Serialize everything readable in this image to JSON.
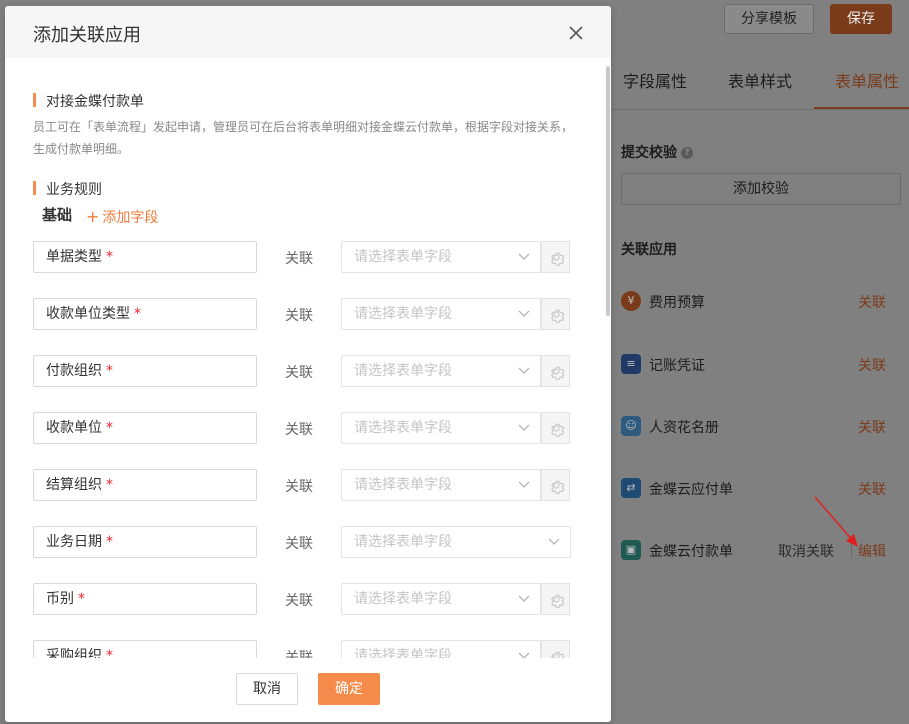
{
  "background": {
    "toolbar": {
      "share_label": "分享模板",
      "save_label": "保存"
    },
    "tabs": [
      {
        "label": "字段属性"
      },
      {
        "label": "表单样式"
      },
      {
        "label": "表单属性"
      }
    ],
    "submit_check": {
      "title": "提交校验",
      "add_button": "添加校验"
    },
    "related_apps": {
      "title": "关联应用",
      "items": [
        {
          "name": "费用预算",
          "icon": "yen-icon",
          "icon_color": "#7a3b1b",
          "action": "关联"
        },
        {
          "name": "记账凭证",
          "icon": "ledger-icon",
          "icon_color": "#1f3a66",
          "action": "关联"
        },
        {
          "name": "人资花名册",
          "icon": "person-icon",
          "icon_color": "#2d5b80",
          "action": "关联"
        },
        {
          "name": "金蝶云应付单",
          "icon": "exchange-icon",
          "icon_color": "#1f4a73",
          "action": "关联"
        },
        {
          "name": "金蝶云付款单",
          "icon": "wallet-icon",
          "icon_color": "#1f5a52",
          "action_unlink": "取消关联",
          "action_edit": "编辑"
        }
      ]
    }
  },
  "modal": {
    "title": "添加关联应用",
    "section1_title": "对接金蝶付款单",
    "description": "员工可在「表单流程」发起申请，管理员可在后台将表单明细对接金蝶云付款单，根据字段对接关系，生成付款单明细。",
    "section2_title": "业务规则",
    "basic_label": "基础",
    "add_field_label": "添加字段",
    "link_label": "关联",
    "select_placeholder": "请选择表单字段",
    "fields": [
      {
        "name": "单据类型",
        "required": "*"
      },
      {
        "name": "收款单位类型",
        "required": "*"
      },
      {
        "name": "付款组织",
        "required": "*"
      },
      {
        "name": "收款单位",
        "required": "*"
      },
      {
        "name": "结算组织",
        "required": "*"
      },
      {
        "name": "业务日期",
        "required": "*"
      },
      {
        "name": "币别",
        "required": "*"
      },
      {
        "name": "采购组织",
        "required": "*"
      }
    ],
    "cancel_label": "取消",
    "ok_label": "确定"
  },
  "colors": {
    "accent": "#f58b4a",
    "required": "#f5222d",
    "annotation_arrow": "#e02020"
  }
}
